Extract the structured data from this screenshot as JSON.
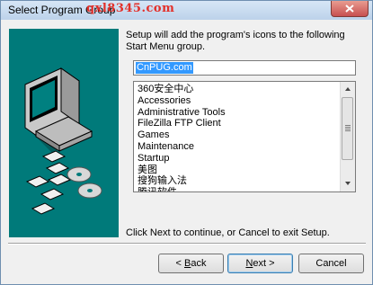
{
  "window": {
    "title": "Select Program Group",
    "watermark": "qxl8345.com",
    "close_icon": "close-x-icon"
  },
  "description": "Setup will add the program's icons to the following Start Menu group.",
  "group_field": {
    "value": "CnPUG.com"
  },
  "program_groups": [
    "360安全中心",
    "Accessories",
    "Administrative Tools",
    "FileZilla FTP Client",
    "Games",
    "Maintenance",
    "Startup",
    "美图",
    "搜狗输入法",
    "腾讯软件"
  ],
  "hint": "Click Next to continue, or Cancel to exit Setup.",
  "buttons": {
    "back": {
      "prefix": "< ",
      "mnemonic": "B",
      "rest": "ack"
    },
    "next": {
      "mnemonic": "N",
      "rest": "ext >"
    },
    "cancel": "Cancel"
  },
  "colors": {
    "side_panel": "#007a7a",
    "selection": "#3399ff",
    "watermark": "#e3302a"
  }
}
